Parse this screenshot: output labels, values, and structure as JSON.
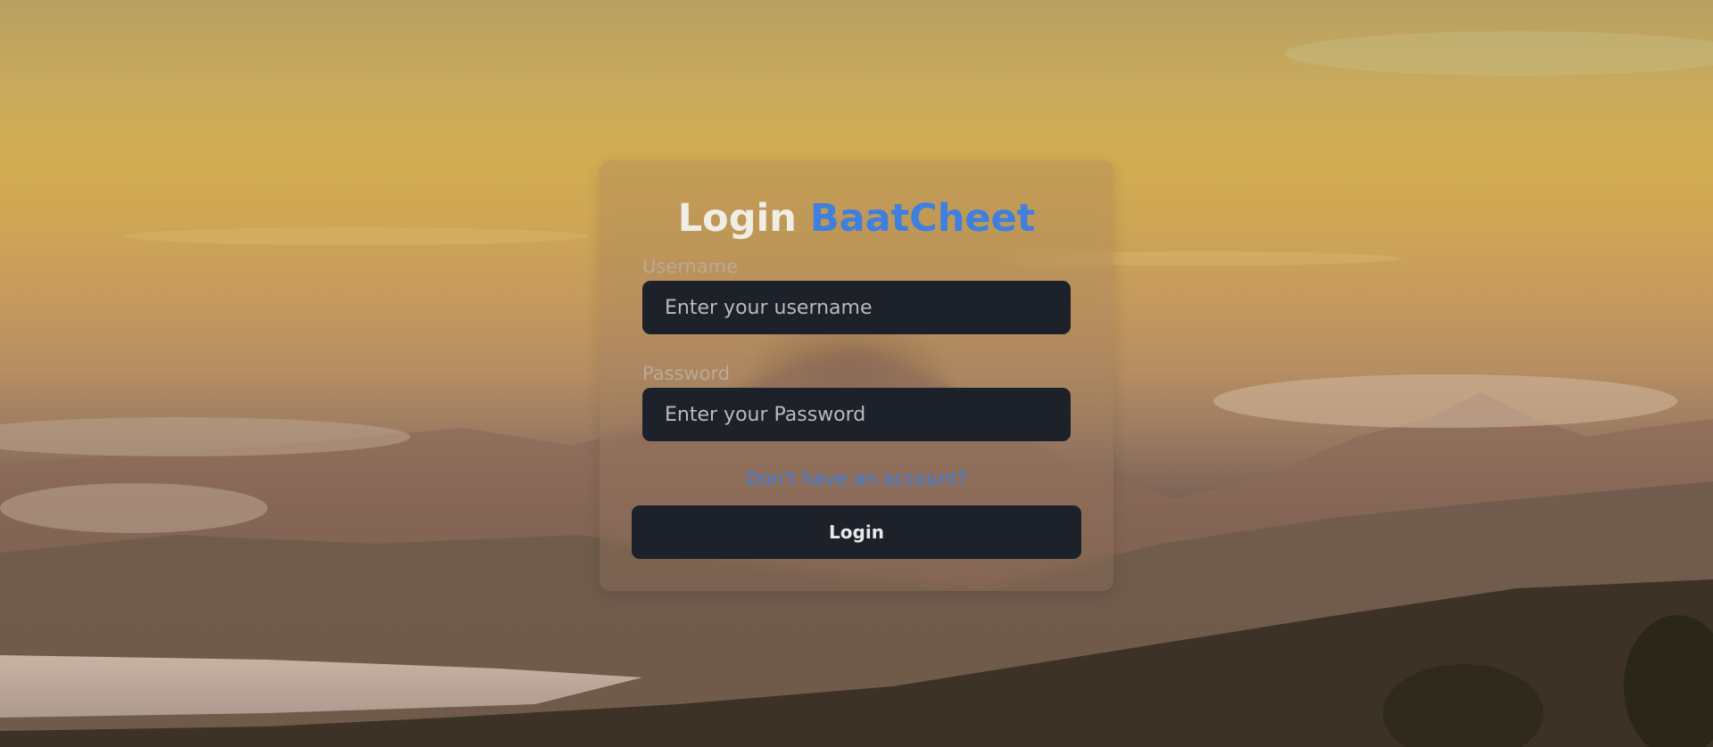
{
  "login_card": {
    "title_prefix": "Login",
    "title_brand": "BaatCheet",
    "username_label": "Username",
    "username_placeholder": "Enter your username",
    "username_value": "",
    "password_label": "Password",
    "password_placeholder": "Enter your Password",
    "password_value": "",
    "signup_link": "Don't have an account?",
    "login_button": "Login"
  },
  "colors": {
    "brand_accent": "#3f7fde",
    "input_background": "#1c212a",
    "button_background": "#1c212a",
    "title_text": "#f0ede6"
  }
}
